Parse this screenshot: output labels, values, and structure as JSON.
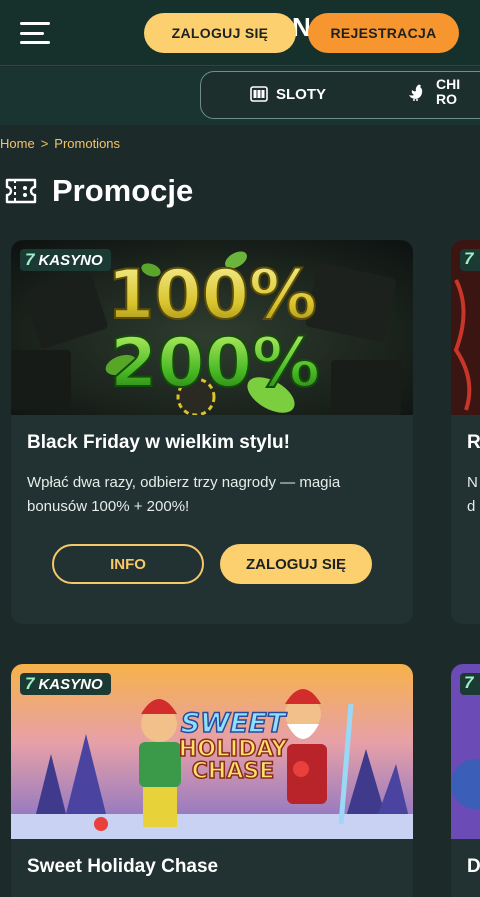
{
  "header": {
    "login_label": "ZALOGUJ SIĘ",
    "register_label": "REJESTRACJA",
    "logo_glyph": "N"
  },
  "categories": [
    {
      "label": "SLOTY",
      "icon": "slot-machine-icon"
    },
    {
      "label": "CHI\nRO",
      "icon": "chicken-icon"
    }
  ],
  "breadcrumb": {
    "home": "Home",
    "separator": ">",
    "current": "Promotions"
  },
  "page": {
    "title": "Promocje",
    "icon": "ticket-icon"
  },
  "promotions": [
    {
      "badge_number": "7",
      "badge_label": "KASYNO",
      "image_text_top": "100%",
      "image_text_bottom": "200%",
      "title": "Black Friday w wielkim stylu!",
      "description": "Wpłać dwa razy, odbierz trzy nagrody — magia bonusów 100% + 200%!",
      "info_label": "INFO",
      "login_label": "ZALOGUJ SIĘ"
    },
    {
      "badge_number": "7",
      "badge_label": "KASYNO",
      "image_text_top": "SWEET",
      "image_text_middle": "HOLIDAY",
      "image_text_bottom": "CHASE",
      "title": "Sweet Holiday Chase"
    }
  ],
  "peek_cards": [
    {
      "badge_number": "7",
      "title_fragment": "R",
      "desc_line1": "N",
      "desc_line2": "d"
    },
    {
      "badge_number": "7",
      "title_fragment": "D"
    }
  ],
  "colors": {
    "background": "#1d2a2a",
    "header": "#16302c",
    "primary_yellow": "#fcd06f",
    "register_orange": "#f7962e",
    "card": "#223131",
    "breadcrumb": "#f2c46a"
  }
}
